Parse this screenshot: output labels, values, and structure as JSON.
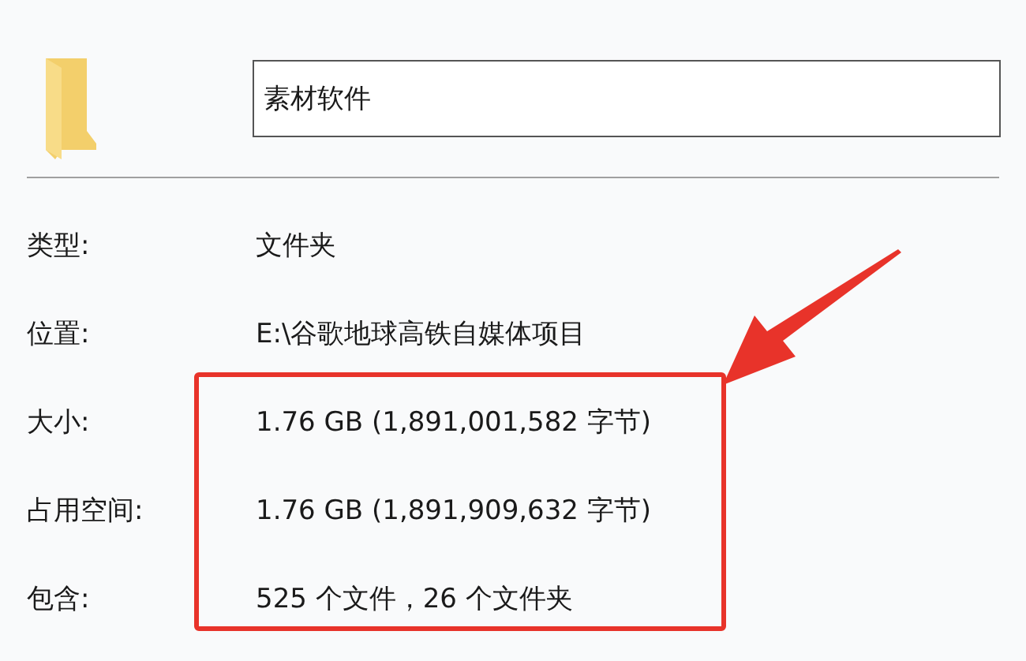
{
  "name_field": {
    "value": "素材软件"
  },
  "properties": [
    {
      "label": "类型:",
      "value": "文件夹"
    },
    {
      "label": "位置:",
      "value": "E:\\谷歌地球高铁自媒体项目"
    },
    {
      "label": "大小:",
      "value": "1.76 GB (1,891,001,582 字节)"
    },
    {
      "label": "占用空间:",
      "value": "1.76 GB (1,891,909,632 字节)"
    },
    {
      "label": "包含:",
      "value": "525 个文件，26 个文件夹"
    }
  ]
}
